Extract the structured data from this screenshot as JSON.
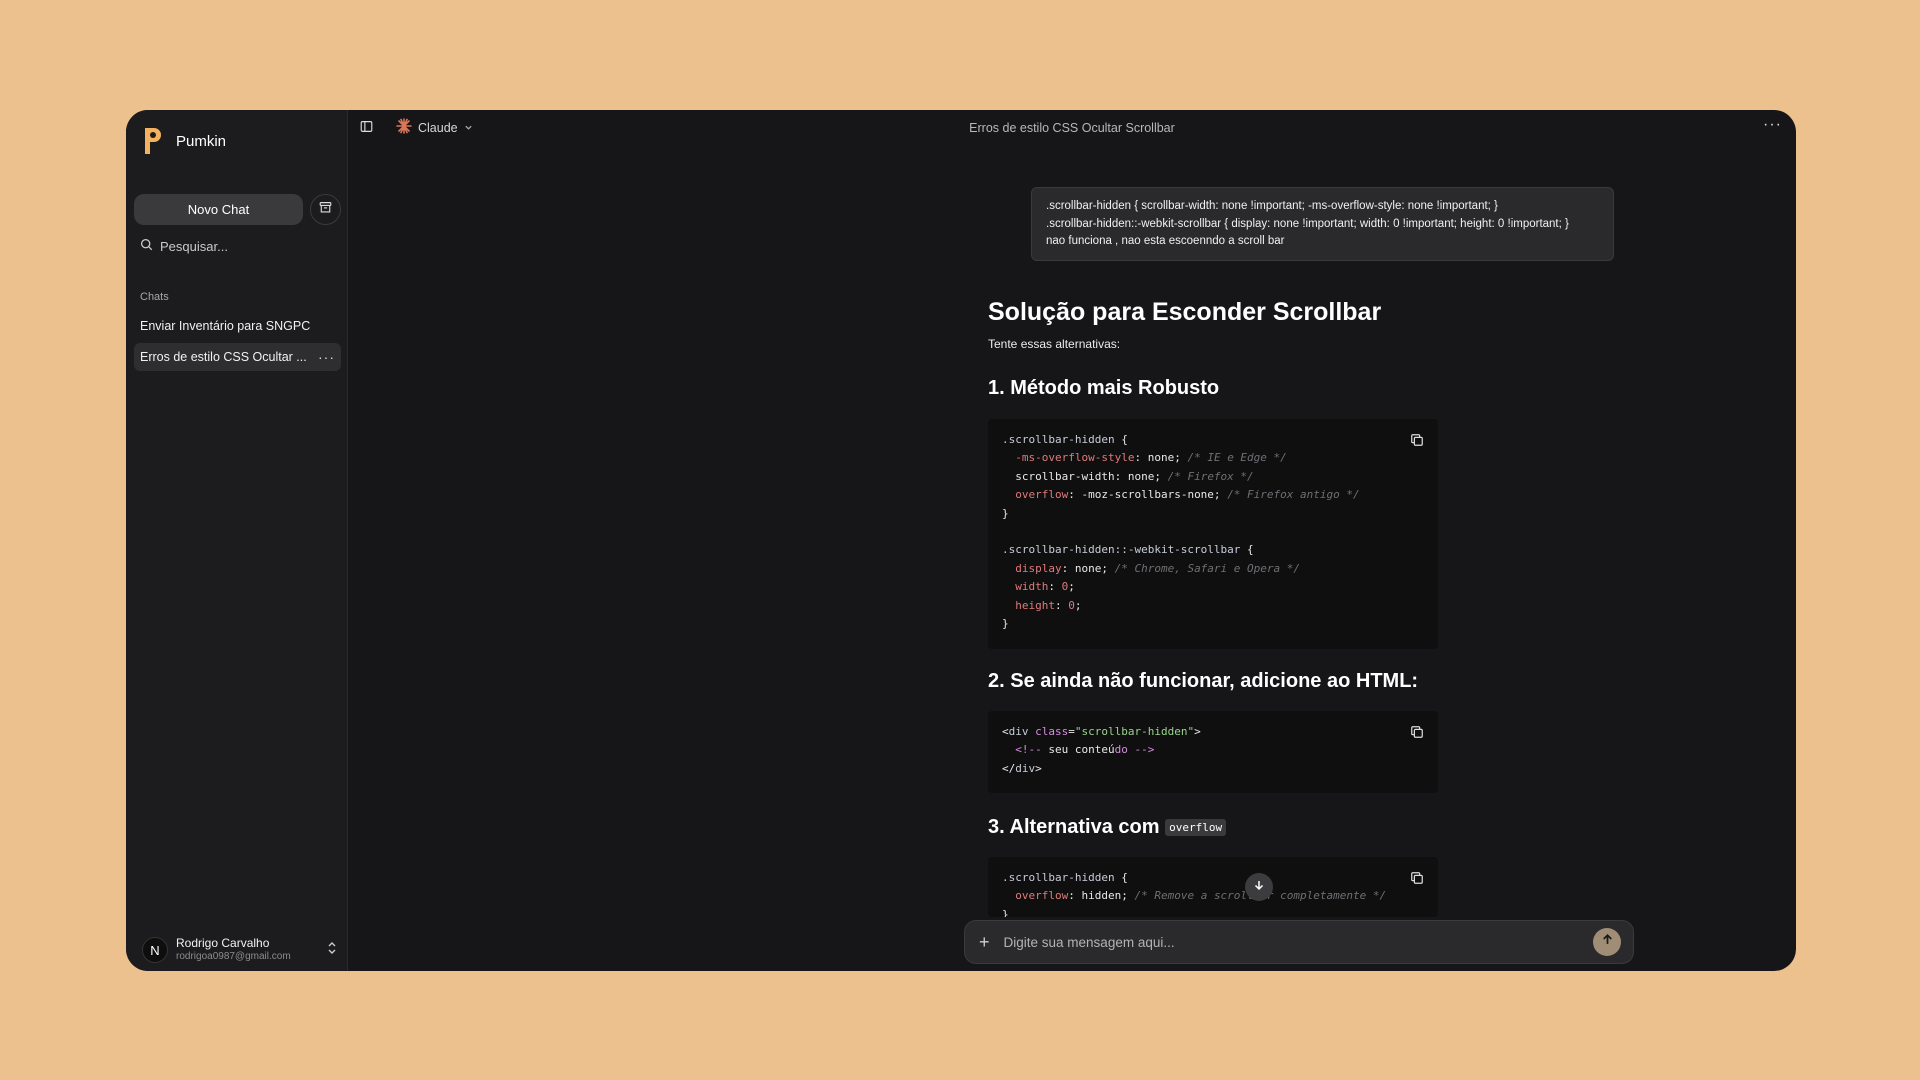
{
  "sidebar": {
    "brand": "Pumkin",
    "new_chat": "Novo Chat",
    "search_placeholder": "Pesquisar...",
    "section_label": "Chats",
    "chats": [
      {
        "label": "Enviar Inventário para SNGPC"
      },
      {
        "label": "Erros de estilo CSS Ocultar ..."
      }
    ],
    "user": {
      "initial": "N",
      "name": "Rodrigo Carvalho",
      "email": "rodrigoa0987@gmail.com"
    }
  },
  "topbar": {
    "model": "Claude",
    "title": "Erros de estilo CSS Ocultar Scrollbar"
  },
  "user_message": {
    "lines": [
      ".scrollbar-hidden { scrollbar-width: none !important; -ms-overflow-style: none !important; }",
      ".scrollbar-hidden::-webkit-scrollbar { display: none !important; width: 0 !important; height: 0 !important; }",
      "nao funciona , nao esta escoenndo a scroll bar"
    ]
  },
  "answer": {
    "title": "Solução para Esconder Scrollbar",
    "intro": "Tente essas alternativas:",
    "h1": "1. Método mais Robusto",
    "h2": "2. Se ainda não funcionar, adicione ao HTML:",
    "h3_text": "3. Alternativa com",
    "h3_code": "overflow"
  },
  "composer": {
    "placeholder": "Digite sua mensagem aqui..."
  },
  "icons": {
    "copy": "copy-icon",
    "archive": "archive-icon",
    "search": "search-icon",
    "send": "arrow-up-icon",
    "scroll": "arrow-down-icon"
  },
  "colors": {
    "background": "#ecc18d",
    "window": "#161618",
    "sidebar": "#1c1c1e",
    "send": "#a08d76"
  }
}
